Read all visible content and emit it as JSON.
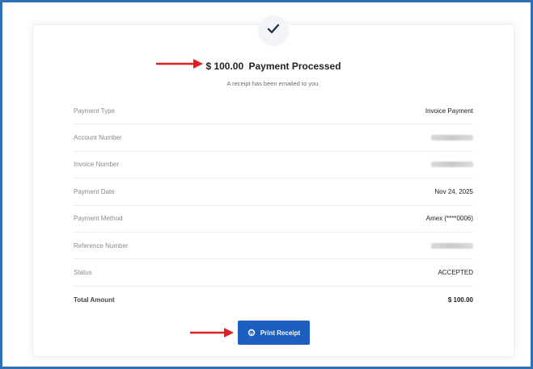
{
  "header": {
    "check_icon": "checkmark-icon",
    "amount": "$ 100.00",
    "title_suffix": "Payment Processed",
    "subtext": "A receipt has been emailed to you."
  },
  "details": [
    {
      "label": "Payment Type",
      "value": "Invoice Payment"
    },
    {
      "label": "Account Number",
      "value": "",
      "redacted": true
    },
    {
      "label": "Invoice Number",
      "value": "",
      "redacted": true
    },
    {
      "label": "Payment Date",
      "value": "Nov 24, 2025"
    },
    {
      "label": "Payment Method",
      "value": "Amex (****0006)"
    },
    {
      "label": "Reference Number",
      "value": "",
      "redacted": true
    },
    {
      "label": "Status",
      "value": "ACCEPTED"
    },
    {
      "label": "Total Amount",
      "value": "$ 100.00"
    }
  ],
  "actions": {
    "print_label": "Print Receipt",
    "print_icon": "print-icon"
  },
  "colors": {
    "frame_border": "#2f6fb3",
    "button_bg": "#1d5fbf",
    "annotation_arrow": "#e02020"
  }
}
